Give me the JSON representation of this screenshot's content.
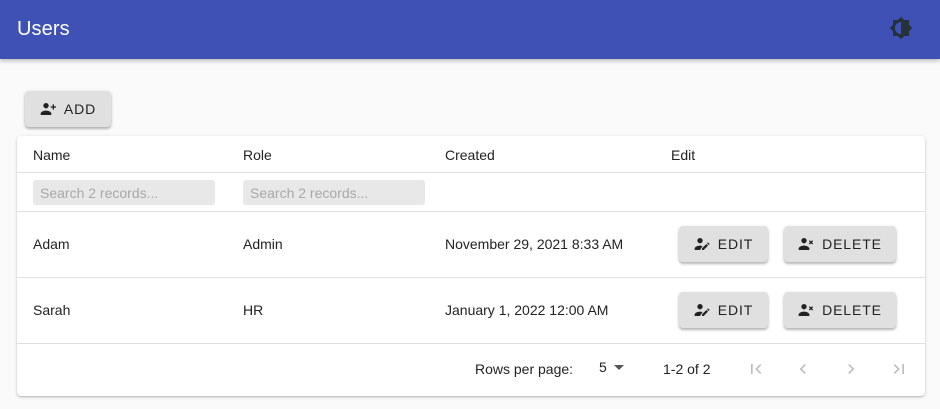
{
  "app": {
    "title": "Users"
  },
  "toolbar": {
    "add_label": "ADD"
  },
  "table": {
    "columns": [
      "Name",
      "Role",
      "Created",
      "Edit"
    ],
    "search_placeholder_name": "Search 2 records...",
    "search_placeholder_role": "Search 2 records...",
    "rows": [
      {
        "name": "Adam",
        "role": "Admin",
        "created": "November 29, 2021 8:33 AM",
        "edit_label": "EDIT",
        "delete_label": "DELETE"
      },
      {
        "name": "Sarah",
        "role": "HR",
        "created": "January 1, 2022 12:00 AM",
        "edit_label": "EDIT",
        "delete_label": "DELETE"
      }
    ]
  },
  "pagination": {
    "rows_per_page_label": "Rows per page:",
    "rows_per_page_value": "5",
    "range": "1-2 of 2"
  },
  "icons": {
    "theme": "brightness-icon",
    "add": "person-add-icon",
    "edit": "person-edit-icon",
    "delete": "person-remove-icon",
    "dropdown": "arrow-drop-down-icon",
    "first": "first-page-icon",
    "prev": "chevron-left-icon",
    "next": "chevron-right-icon",
    "last": "last-page-icon"
  },
  "colors": {
    "appbar": "#3f51b5",
    "button": "#e0e0e0",
    "pager_disabled": "#bdbdbd"
  }
}
